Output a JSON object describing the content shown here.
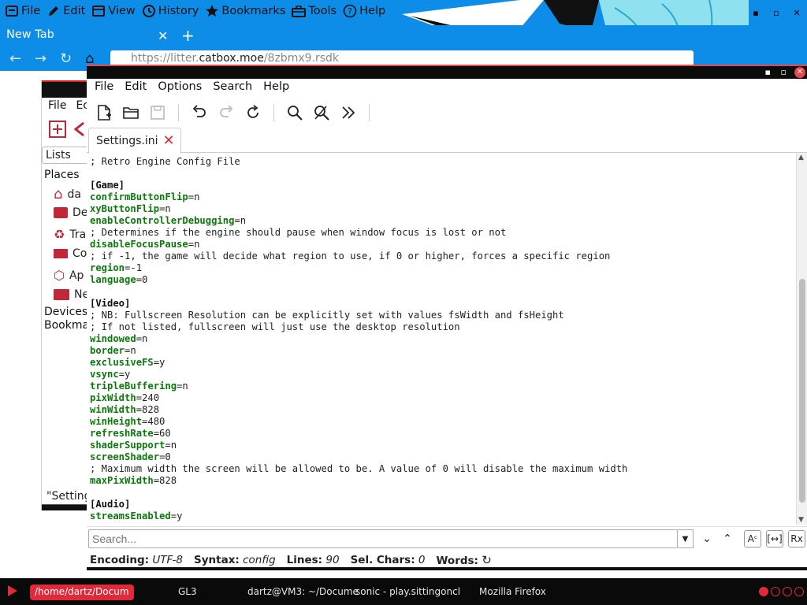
{
  "firefox": {
    "menu": [
      {
        "icon": "file-icon",
        "label": "File"
      },
      {
        "icon": "pencil-icon",
        "label": "Edit"
      },
      {
        "icon": "view-icon",
        "label": "View"
      },
      {
        "icon": "history-icon",
        "label": "History"
      },
      {
        "icon": "star-icon",
        "label": "Bookmarks"
      },
      {
        "icon": "toolbox-icon",
        "label": "Tools"
      },
      {
        "icon": "help-icon",
        "label": "Help"
      }
    ],
    "tab_title": "New Tab",
    "url_prefix": "https://litter.",
    "url_host": "catbox.moe",
    "url_path": "/8zbmx9.rsdk",
    "colors": {
      "chrome": "#0d8de8"
    }
  },
  "thunar": {
    "menu": [
      "File",
      "Ec"
    ],
    "lists_label": "Lists",
    "places_label": "Places",
    "places": [
      {
        "icon": "home-icon",
        "label": "da"
      },
      {
        "icon": "desktop-icon",
        "label": "De"
      },
      {
        "icon": "trash-icon",
        "label": "Tra"
      },
      {
        "icon": "computer-icon",
        "label": "Co"
      },
      {
        "icon": "applications-icon",
        "label": "Ap"
      },
      {
        "icon": "folder-icon",
        "label": "Ne"
      }
    ],
    "devices_label": "Devices",
    "bookmarks_label": "Bookmar",
    "status": "\"Setting"
  },
  "featherpad": {
    "menu": [
      "File",
      "Edit",
      "Options",
      "Search",
      "Help"
    ],
    "tab_title": "Settings.ini",
    "lines": [
      [
        [
          "cmt",
          "; Retro Engine Config File"
        ]
      ],
      [],
      [
        [
          "sec",
          "[Game]"
        ]
      ],
      [
        [
          "key",
          "confirmButtonFlip"
        ],
        [
          "txt",
          "=n"
        ]
      ],
      [
        [
          "key",
          "xyButtonFlip"
        ],
        [
          "txt",
          "=n"
        ]
      ],
      [
        [
          "key",
          "enableControllerDebugging"
        ],
        [
          "txt",
          "=n"
        ]
      ],
      [
        [
          "cmt",
          "; Determines if the engine should pause when window focus is lost or not"
        ]
      ],
      [
        [
          "key",
          "disableFocusPause"
        ],
        [
          "txt",
          "=n"
        ]
      ],
      [
        [
          "cmt",
          "; if -1, the game will decide what region to use, if 0 or higher, forces a specific region"
        ]
      ],
      [
        [
          "key",
          "region"
        ],
        [
          "txt",
          "=-1"
        ]
      ],
      [
        [
          "key",
          "language"
        ],
        [
          "txt",
          "=0"
        ]
      ],
      [],
      [
        [
          "sec",
          "[Video]"
        ]
      ],
      [
        [
          "cmt",
          "; NB: Fullscreen Resolution can be explicitly set with values fsWidth and fsHeight"
        ]
      ],
      [
        [
          "cmt",
          "; If not listed, fullscreen will just use the desktop resolution"
        ]
      ],
      [
        [
          "key",
          "windowed"
        ],
        [
          "txt",
          "=n"
        ]
      ],
      [
        [
          "key",
          "border"
        ],
        [
          "txt",
          "=n"
        ]
      ],
      [
        [
          "key",
          "exclusiveFS"
        ],
        [
          "txt",
          "=y"
        ]
      ],
      [
        [
          "key",
          "vsync"
        ],
        [
          "txt",
          "=y"
        ]
      ],
      [
        [
          "key",
          "tripleBuffering"
        ],
        [
          "txt",
          "=n"
        ]
      ],
      [
        [
          "key",
          "pixWidth"
        ],
        [
          "txt",
          "=240"
        ]
      ],
      [
        [
          "key",
          "winWidth"
        ],
        [
          "txt",
          "=828"
        ]
      ],
      [
        [
          "key",
          "winHeight"
        ],
        [
          "txt",
          "=480"
        ]
      ],
      [
        [
          "key",
          "refreshRate"
        ],
        [
          "txt",
          "=60"
        ]
      ],
      [
        [
          "key",
          "shaderSupport"
        ],
        [
          "txt",
          "=n"
        ]
      ],
      [
        [
          "key",
          "screenShader"
        ],
        [
          "txt",
          "=0"
        ]
      ],
      [
        [
          "cmt",
          "; Maximum width the screen will be allowed to be. A value of 0 will disable the maximum width"
        ]
      ],
      [
        [
          "key",
          "maxPixWidth"
        ],
        [
          "txt",
          "=828"
        ]
      ],
      [],
      [
        [
          "sec",
          "[Audio]"
        ]
      ],
      [
        [
          "key",
          "streamsEnabled"
        ],
        [
          "txt",
          "=y"
        ]
      ]
    ],
    "search_placeholder": "Search...",
    "status": {
      "encoding_label": "Encoding:",
      "encoding_value": "UTF-8",
      "syntax_label": "Syntax:",
      "syntax_value": "config",
      "lines_label": "Lines:",
      "lines_value": "90",
      "selchars_label": "Sel. Chars:",
      "selchars_value": "0",
      "words_label": "Words:"
    },
    "colors": {
      "key": "#0b7a0b",
      "close": "#d9303a"
    }
  },
  "taskbar": {
    "tasks": [
      {
        "label": "/home/dartz/Docum",
        "active": true
      },
      {
        "label": "GL3",
        "active": false
      },
      {
        "label": "dartz@VM3: ~/Docume",
        "active": false
      },
      {
        "label": "sonic - play.sittingoncl",
        "active": false
      },
      {
        "label": "Mozilla Firefox",
        "active": false
      }
    ],
    "accent": "#e02a3a"
  }
}
